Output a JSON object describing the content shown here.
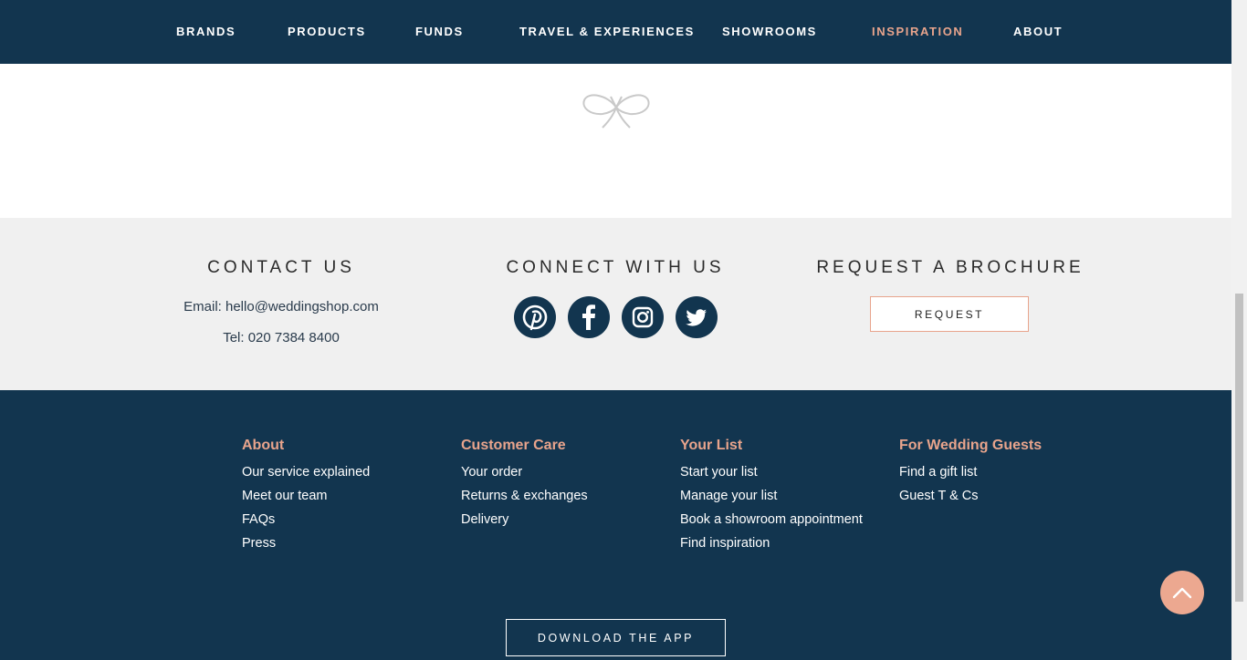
{
  "nav": {
    "items": [
      {
        "label": "BRANDS",
        "active": false
      },
      {
        "label": "PRODUCTS",
        "active": false
      },
      {
        "label": "FUNDS",
        "active": false
      },
      {
        "label": "TRAVEL & EXPERIENCES",
        "active": false
      },
      {
        "label": "SHOWROOMS",
        "active": false
      },
      {
        "label": "INSPIRATION",
        "active": true
      },
      {
        "label": "ABOUT",
        "active": false
      }
    ]
  },
  "contact": {
    "heading": "CONTACT US",
    "email": "Email: hello@weddingshop.com",
    "tel": "Tel: 020 7384 8400"
  },
  "connect": {
    "heading": "CONNECT WITH US",
    "icons": [
      "pinterest-icon",
      "facebook-icon",
      "instagram-icon",
      "twitter-icon"
    ]
  },
  "brochure": {
    "heading": "REQUEST A BROCHURE",
    "button": "REQUEST"
  },
  "footer": {
    "columns": [
      {
        "heading": "About",
        "links": [
          "Our service explained",
          "Meet our team",
          "FAQs",
          "Press"
        ]
      },
      {
        "heading": "Customer Care",
        "links": [
          "Your order",
          "Returns & exchanges",
          "Delivery"
        ]
      },
      {
        "heading": "Your List",
        "links": [
          "Start your list",
          "Manage your list",
          "Book a showroom appointment",
          "Find inspiration"
        ]
      },
      {
        "heading": "For Wedding Guests",
        "links": [
          "Find a gift list",
          "Guest T & Cs"
        ]
      }
    ],
    "app_button": "DOWNLOAD THE APP"
  },
  "colors": {
    "navy": "#12354f",
    "accent": "#e8a48c",
    "band": "#f0f0f0"
  }
}
